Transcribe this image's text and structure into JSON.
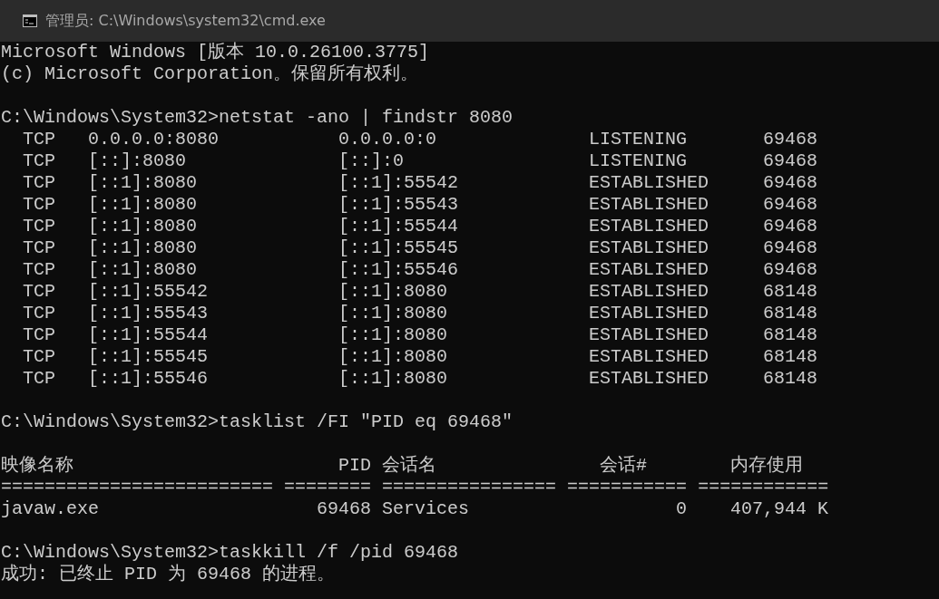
{
  "window": {
    "title": "管理员: C:\\Windows\\system32\\cmd.exe"
  },
  "console": [
    {
      "kind": "text",
      "text": "Microsoft Windows [版本 10.0.26100.3775]"
    },
    {
      "kind": "text",
      "text": "(c) Microsoft Corporation。保留所有权利。"
    },
    {
      "kind": "blank"
    },
    {
      "kind": "command",
      "text": "C:\\Windows\\System32>netstat -ano | findstr 8080"
    },
    {
      "kind": "netstat_row",
      "cells": [
        "TCP",
        "0.0.0.0:8080",
        "0.0.0.0:0",
        "LISTENING",
        "69468"
      ]
    },
    {
      "kind": "netstat_row",
      "cells": [
        "TCP",
        "[::]:8080",
        "[::]:0",
        "LISTENING",
        "69468"
      ]
    },
    {
      "kind": "netstat_row",
      "cells": [
        "TCP",
        "[::1]:8080",
        "[::1]:55542",
        "ESTABLISHED",
        "69468"
      ]
    },
    {
      "kind": "netstat_row",
      "cells": [
        "TCP",
        "[::1]:8080",
        "[::1]:55543",
        "ESTABLISHED",
        "69468"
      ]
    },
    {
      "kind": "netstat_row",
      "cells": [
        "TCP",
        "[::1]:8080",
        "[::1]:55544",
        "ESTABLISHED",
        "69468"
      ]
    },
    {
      "kind": "netstat_row",
      "cells": [
        "TCP",
        "[::1]:8080",
        "[::1]:55545",
        "ESTABLISHED",
        "69468"
      ]
    },
    {
      "kind": "netstat_row",
      "cells": [
        "TCP",
        "[::1]:8080",
        "[::1]:55546",
        "ESTABLISHED",
        "69468"
      ]
    },
    {
      "kind": "netstat_row",
      "cells": [
        "TCP",
        "[::1]:55542",
        "[::1]:8080",
        "ESTABLISHED",
        "68148"
      ]
    },
    {
      "kind": "netstat_row",
      "cells": [
        "TCP",
        "[::1]:55543",
        "[::1]:8080",
        "ESTABLISHED",
        "68148"
      ]
    },
    {
      "kind": "netstat_row",
      "cells": [
        "TCP",
        "[::1]:55544",
        "[::1]:8080",
        "ESTABLISHED",
        "68148"
      ]
    },
    {
      "kind": "netstat_row",
      "cells": [
        "TCP",
        "[::1]:55545",
        "[::1]:8080",
        "ESTABLISHED",
        "68148"
      ]
    },
    {
      "kind": "netstat_row",
      "cells": [
        "TCP",
        "[::1]:55546",
        "[::1]:8080",
        "ESTABLISHED",
        "68148"
      ]
    },
    {
      "kind": "blank"
    },
    {
      "kind": "command",
      "text": "C:\\Windows\\System32>tasklist /FI \"PID eq 69468\""
    },
    {
      "kind": "blank"
    },
    {
      "kind": "tasklist_header",
      "cells": [
        "映像名称",
        "PID",
        "会话名",
        "会话#",
        "内存使用"
      ]
    },
    {
      "kind": "text",
      "text": "========================= ======== ================ =========== ============"
    },
    {
      "kind": "tasklist_row",
      "cells": [
        "javaw.exe",
        "69468",
        "Services",
        "0",
        "407,944 K"
      ]
    },
    {
      "kind": "blank"
    },
    {
      "kind": "command",
      "text": "C:\\Windows\\System32>taskkill /f /pid 69468"
    },
    {
      "kind": "text",
      "text": "成功: 已终止 PID 为 69468 的进程。"
    }
  ]
}
